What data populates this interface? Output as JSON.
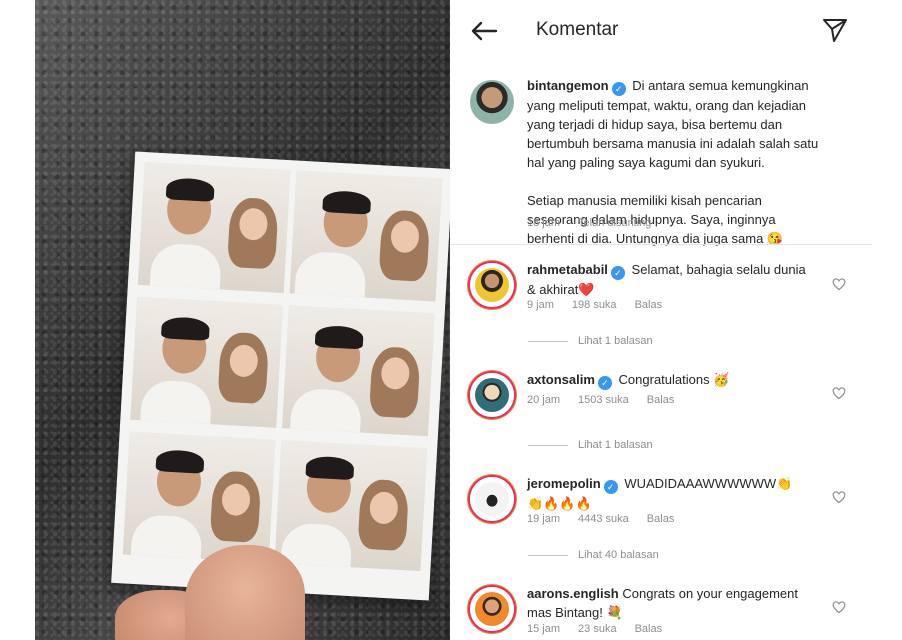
{
  "header": {
    "title": "Komentar"
  },
  "caption": {
    "username": "bintangemon",
    "text_line1": "Di antara semua kemungkinan",
    "text_lines": [
      "yang meliputi tempat, waktu, orang dan kejadian",
      "yang terjadi di hidup saya, bisa bertemu dan",
      "bertumbuh bersama manusia ini adalah salah satu",
      "hal yang paling saya kagumi dan syukuri."
    ],
    "paragraph2": [
      "Setiap manusia memiliki kisah pencarian",
      "seseorang dalam hidupnya. Saya, inginnya",
      "berhenti di dia. Untungnya dia juga sama 😘"
    ],
    "time": "18 jam",
    "edited": "Telah disunting"
  },
  "comments": [
    {
      "username": "rahmetababil",
      "text_line1": "Selamat, bahagia selalu dunia",
      "text_line2": "& akhirat❤️",
      "time": "9 jam",
      "likes": "198 suka",
      "reply": "Balas",
      "view_replies": "Lihat 1 balasan"
    },
    {
      "username": "axtonsalim",
      "text_line1": "Congratulations 🥳",
      "time": "20 jam",
      "likes": "1503 suka",
      "reply": "Balas",
      "view_replies": "Lihat 1 balasan"
    },
    {
      "username": "jeromepolin",
      "text_line1": "WUADIDAAAWWWWWW👏",
      "text_line2": "👏🔥🔥🔥",
      "time": "19 jam",
      "likes": "4443 suka",
      "reply": "Balas",
      "view_replies": "Lihat 40 balasan"
    },
    {
      "username": "aarons.english",
      "text_line1": "Congrats on your engagement",
      "text_line2": "mas Bintang! 💐",
      "time": "15 jam",
      "likes": "23 suka",
      "reply": "Balas"
    }
  ],
  "colors": {
    "verified": "#3897f0",
    "meta_text": "#8e8e8e",
    "ring_pink": "#e1306c",
    "ring_orange": "#f58529"
  }
}
